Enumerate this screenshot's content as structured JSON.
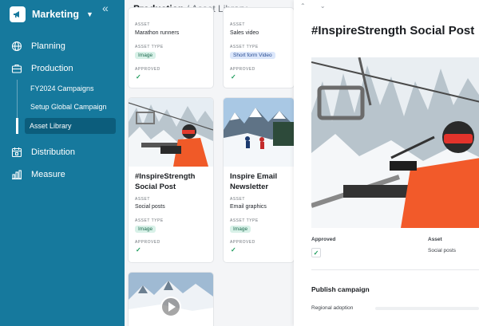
{
  "sidebar": {
    "brand": "Marketing",
    "nav": [
      {
        "label": "Planning"
      },
      {
        "label": "Production"
      },
      {
        "label": "Distribution"
      },
      {
        "label": "Measure"
      }
    ],
    "sub": [
      {
        "label": "FY2024 Campaigns"
      },
      {
        "label": "Setup Global Campaign"
      },
      {
        "label": "Asset Library"
      }
    ]
  },
  "header": {
    "section": "Production",
    "separator": "/",
    "page": "Asset Library"
  },
  "cards": [
    {
      "title": "",
      "asset_label": "ASSET",
      "asset": "Marathon runners",
      "type_label": "ASSET TYPE",
      "type": "Image",
      "approved_label": "APPROVED",
      "approved": "✓"
    },
    {
      "title": "",
      "asset_label": "ASSET",
      "asset": "Sales video",
      "type_label": "ASSET TYPE",
      "type": "Short form Video",
      "approved_label": "APPROVED",
      "approved": "✓"
    },
    {
      "title_line1": "#InspireStrength",
      "title_line2": "Social Post",
      "asset_label": "ASSET",
      "asset": "Social posts",
      "type_label": "ASSET TYPE",
      "type": "Image",
      "approved_label": "APPROVED",
      "approved": "✓"
    },
    {
      "title_line1": "Inspire Email",
      "title_line2": "Newsletter",
      "asset_label": "ASSET",
      "asset": "Email graphics",
      "type_label": "ASSET TYPE",
      "type": "Image",
      "approved_label": "APPROVED",
      "approved": "✓"
    }
  ],
  "panel": {
    "nav_arrows": "⌃ ⌄",
    "title": "#InspireStrength Social Post",
    "approved_label": "Approved",
    "approved": "✓",
    "asset_label": "Asset",
    "asset": "Social posts",
    "section": "Publish campaign",
    "regional": "Regional adoption"
  },
  "colors": {
    "sidebar": "#16799d",
    "active": "#0c5d7c",
    "approved": "#1d9b5b"
  },
  "icons": [
    "megaphone-icon",
    "collapse-icon",
    "globe-icon",
    "briefcase-icon",
    "calendar-icon",
    "bar-chart-icon",
    "play-icon",
    "check-icon"
  ]
}
